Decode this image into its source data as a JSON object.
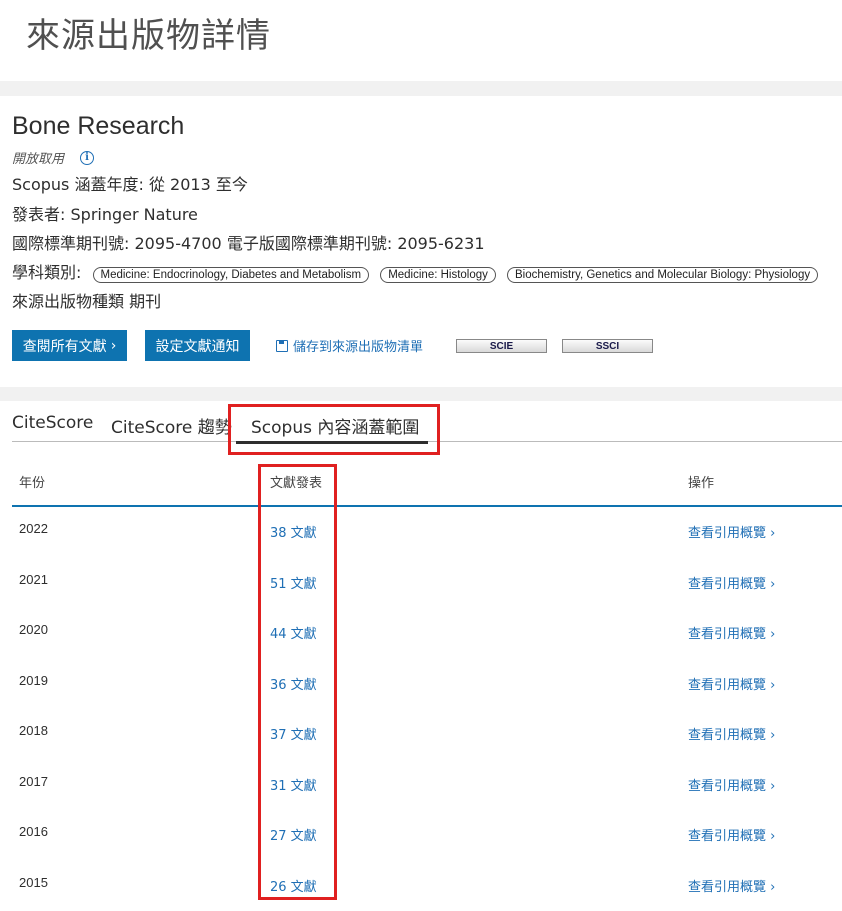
{
  "page_title": "來源出版物詳情",
  "source": {
    "title": "Bone Research",
    "open_access": "開放取用",
    "coverage_label": "Scopus 涵蓋年度:",
    "coverage_value": "從 2013 至今",
    "publisher_label": "發表者:",
    "publisher_value": "Springer Nature",
    "issn_label": "國際標準期刊號:",
    "issn_value": "2095-4700",
    "eissn_label": "電子版國際標準期刊號:",
    "eissn_value": "2095-6231",
    "subject_label": "學科類別:",
    "subjects": [
      "Medicine: Endocrinology, Diabetes and Metabolism",
      "Medicine: Histology",
      "Biochemistry, Genetics and Molecular Biology: Physiology"
    ],
    "type_label": "來源出版物種類",
    "type_value": "期刊"
  },
  "actions": {
    "view_all": "查閱所有文獻",
    "set_alert": "設定文獻通知",
    "save_list": "儲存到來源出版物清單",
    "badges": [
      "SCIE",
      "SSCI"
    ]
  },
  "tabs": [
    "CiteScore",
    "CiteScore 趨勢",
    "Scopus 內容涵蓋範圍"
  ],
  "table": {
    "headers": [
      "年份",
      "文獻發表",
      "操作"
    ],
    "rows": [
      {
        "year": "2022",
        "docs": "38 文獻",
        "action": "查看引用概覽"
      },
      {
        "year": "2021",
        "docs": "51 文獻",
        "action": "查看引用概覽"
      },
      {
        "year": "2020",
        "docs": "44 文獻",
        "action": "查看引用概覽"
      },
      {
        "year": "2019",
        "docs": "36 文獻",
        "action": "查看引用概覽"
      },
      {
        "year": "2018",
        "docs": "37 文獻",
        "action": "查看引用概覽"
      },
      {
        "year": "2017",
        "docs": "31 文獻",
        "action": "查看引用概覽"
      },
      {
        "year": "2016",
        "docs": "27 文獻",
        "action": "查看引用概覽"
      },
      {
        "year": "2015",
        "docs": "26 文獻",
        "action": "查看引用概覽"
      }
    ]
  },
  "colors": {
    "accent": "#0e73b0",
    "link": "#1f6fb5",
    "highlight": "#e02020"
  }
}
